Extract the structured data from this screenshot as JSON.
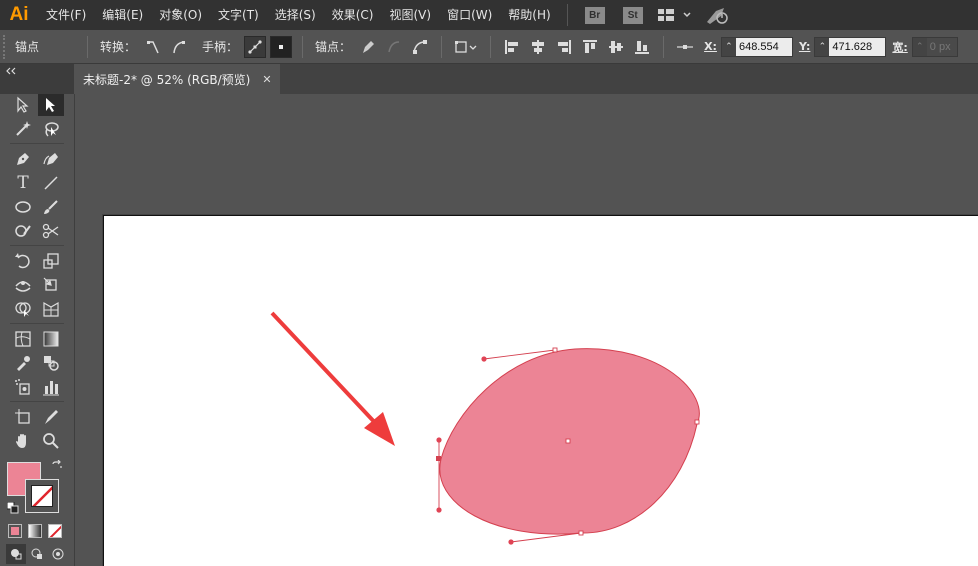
{
  "app": {
    "logo_text": "Ai"
  },
  "menu": {
    "items": [
      "文件(F)",
      "编辑(E)",
      "对象(O)",
      "文字(T)",
      "选择(S)",
      "效果(C)",
      "视图(V)",
      "窗口(W)",
      "帮助(H)"
    ],
    "bridge_badge": "Br",
    "stock_badge": "St"
  },
  "control_bar": {
    "panel_title": "锚点",
    "convert_label": "转换：",
    "handles_label": "手柄：",
    "anchor_label": "锚点：",
    "x_label": "X:",
    "x_value": "648.554",
    "y_label": "Y:",
    "y_value": "471.628",
    "width_label": "宽:",
    "width_value": "0 px"
  },
  "document_tab": {
    "title": "未标题-2* @ 52% (RGB/预览)",
    "close_glyph": "✕"
  },
  "toolbox": {
    "type_glyph": "T",
    "fill_color": "#ec8495",
    "stroke_color": "none"
  },
  "artwork": {
    "shape": "ellipse",
    "fill_color": "#ec8495",
    "stroke_color": "#d4404f",
    "arrow_color": "#ee3c3c"
  }
}
